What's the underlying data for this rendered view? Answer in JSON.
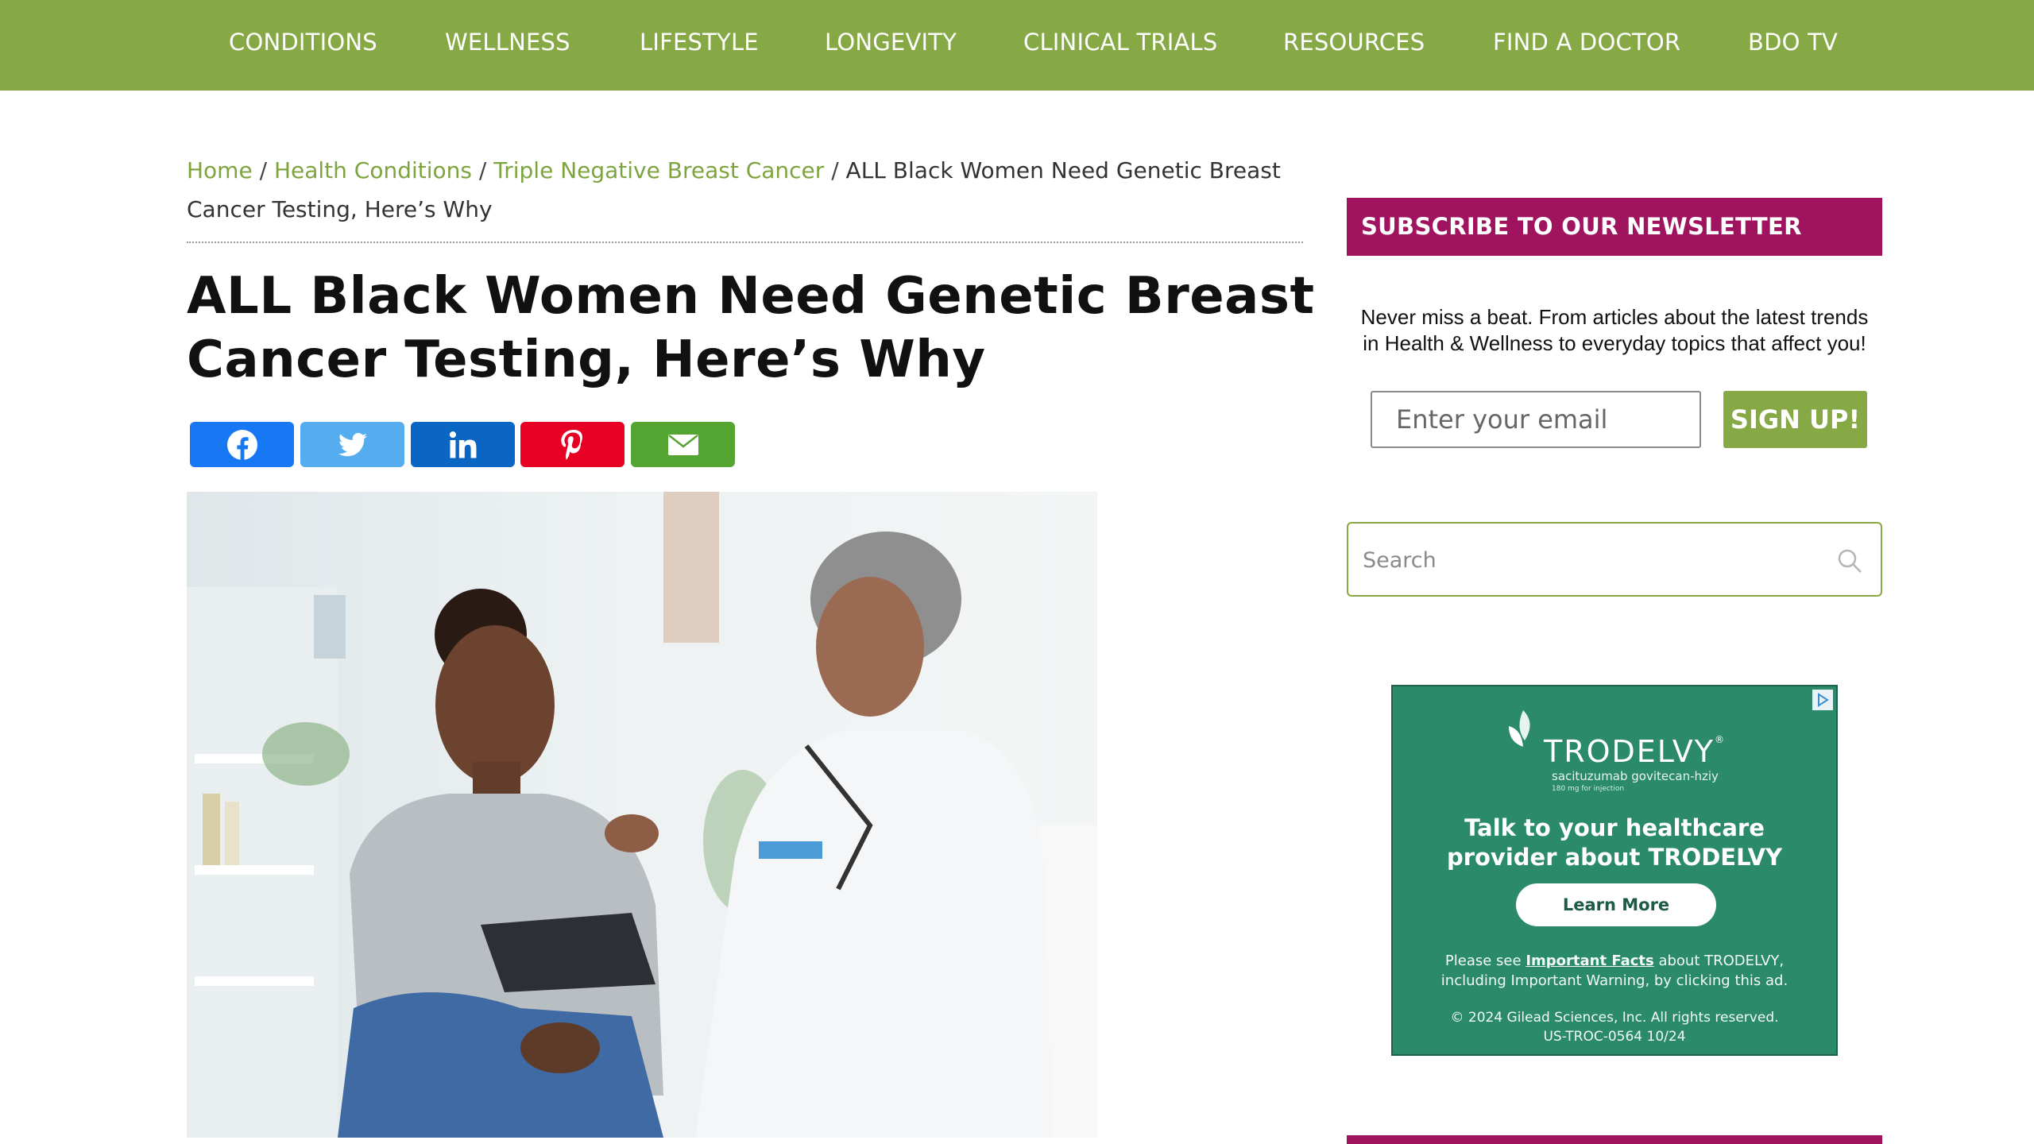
{
  "nav": {
    "items": [
      "CONDITIONS",
      "WELLNESS",
      "LIFESTYLE",
      "LONGEVITY",
      "CLINICAL TRIALS",
      "RESOURCES",
      "FIND A DOCTOR",
      "BDO TV"
    ]
  },
  "breadcrumb": {
    "home": "Home",
    "sep": "/",
    "health_conditions": "Health Conditions",
    "category": "Triple Negative Breast Cancer",
    "current": "ALL Black Women Need Genetic Breast Cancer Testing, Here’s Why"
  },
  "article": {
    "title": "ALL Black Women Need Genetic Breast Cancer Testing, Here’s Why"
  },
  "share": {
    "buttons": [
      {
        "network": "facebook",
        "icon": "facebook-icon",
        "color": "#1877f2"
      },
      {
        "network": "twitter",
        "icon": "twitter-icon",
        "color": "#55acee"
      },
      {
        "network": "linkedin",
        "icon": "linkedin-icon",
        "color": "#0a66c2"
      },
      {
        "network": "pinterest",
        "icon": "pinterest-icon",
        "color": "#e60023"
      },
      {
        "network": "email",
        "icon": "email-icon",
        "color": "#55a532"
      }
    ]
  },
  "sidebar": {
    "newsletter": {
      "heading": "SUBSCRIBE TO OUR NEWSLETTER",
      "text_line1": "Never miss a beat. From articles about the latest trends",
      "text_line2": "in Health & Wellness to everyday topics that affect you!",
      "email_placeholder": "Enter your email",
      "signup_label": "SIGN UP!"
    },
    "search": {
      "placeholder": "Search"
    },
    "ad": {
      "brand": "TRODELVY",
      "generic": "sacituzumab govitecan-hziy",
      "dose": "180 mg for injection",
      "headline_line1": "Talk to your healthcare",
      "headline_line2": "provider about TRODELVY",
      "cta": "Learn More",
      "important_pre": "Please see",
      "important_link": "Important Facts",
      "important_post": "about TRODELVY,",
      "important_line2": "including Important Warning, by clicking this ad.",
      "copyright_line1": "© 2024 Gilead Sciences, Inc. All rights reserved.",
      "copyright_line2": "US-TROC-0564 10/24"
    }
  },
  "colors": {
    "nav_green": "#86a946",
    "link_green": "#7ea43f",
    "newsletter_magenta": "#a0145f",
    "ad_green": "#2a8a6a"
  }
}
